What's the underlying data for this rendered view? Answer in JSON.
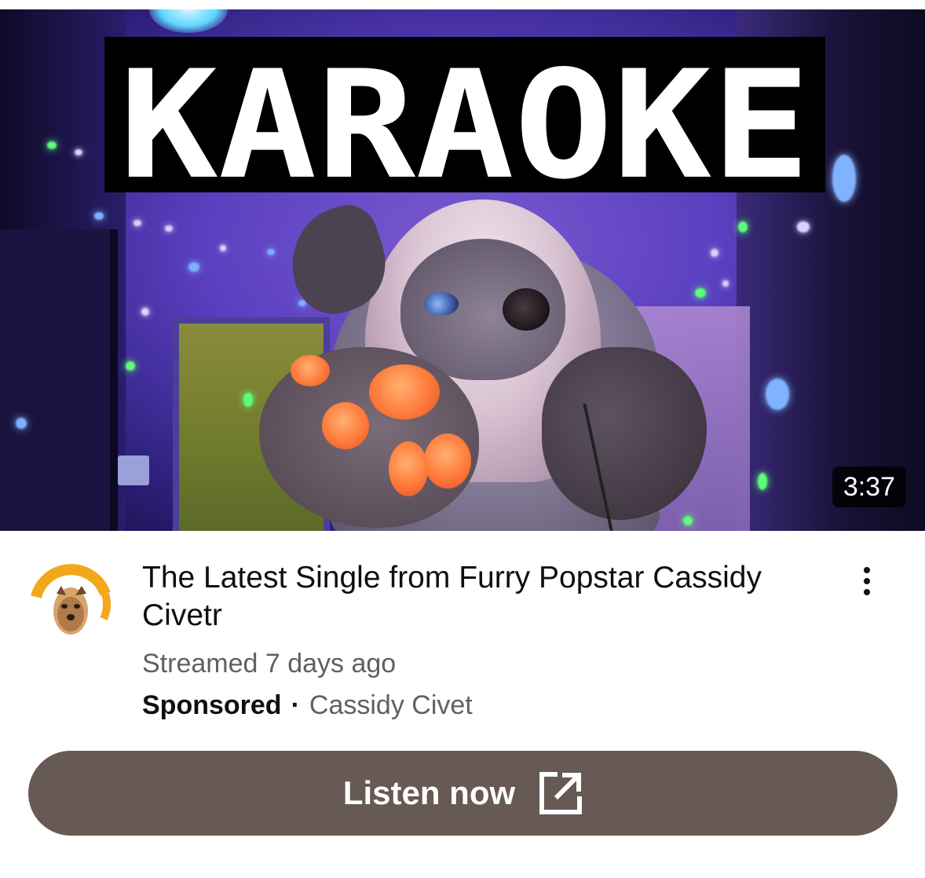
{
  "thumbnail": {
    "banner_text": "KARAOKE",
    "duration": "3:37"
  },
  "video": {
    "title": "The Latest Single from Furry Popstar Cassidy Civetr",
    "meta": "Streamed 7 days ago",
    "sponsored_label": "Sponsored",
    "separator": "·",
    "channel": "Cassidy Civet",
    "avatar_text": "Cassidy Civet"
  },
  "cta": {
    "label": "Listen now",
    "icon": "external-link-icon"
  },
  "colors": {
    "cta_background": "#675953",
    "title_text": "#0f0f0f",
    "secondary_text": "#606060",
    "avatar_accent": "#f2a81c"
  }
}
